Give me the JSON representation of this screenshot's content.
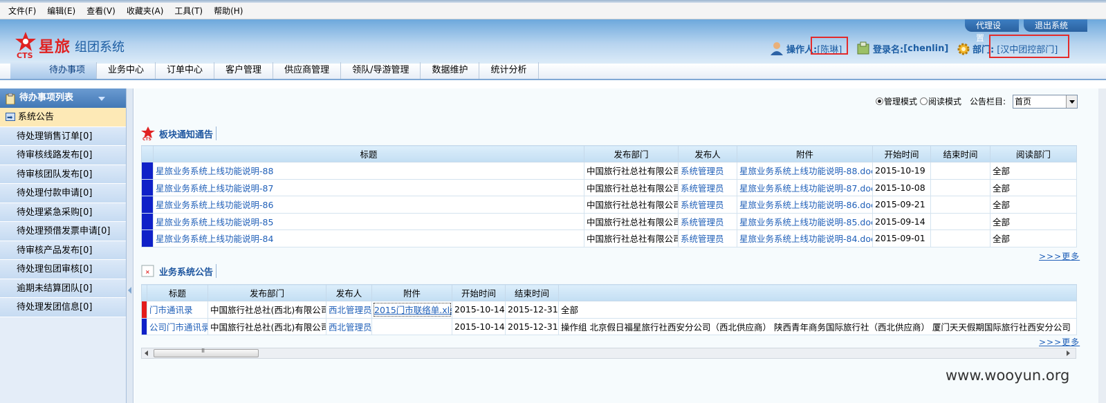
{
  "menu": [
    "文件(F)",
    "编辑(E)",
    "查看(V)",
    "收藏夹(A)",
    "工具(T)",
    "帮助(H)"
  ],
  "header": {
    "brand": "星旅",
    "brand_sub": "组团系统",
    "logo_text": "CTS",
    "proxy_btn": "代理设置",
    "exit_btn": "退出系统",
    "operator_label": "操作人:",
    "operator_value": "[陈琳]",
    "login_label": "登录名:",
    "login_value": "[chenlin]",
    "dept_label": "部门:",
    "dept_value": "[汉中团控部门]"
  },
  "nav": [
    "待办事项",
    "业务中心",
    "订单中心",
    "客户管理",
    "供应商管理",
    "领队/导游管理",
    "数据维护",
    "统计分析"
  ],
  "sidebar": {
    "title": "待办事项列表",
    "notice": "系统公告",
    "items": [
      "待处理销售订单[0]",
      "待审核线路发布[0]",
      "待审核团队发布[0]",
      "待处理付款申请[0]",
      "待处理紧急采购[0]",
      "待处理预借发票申请[0]",
      "待审核产品发布[0]",
      "待处理包团审核[0]",
      "逾期未结算团队[0]",
      "待处理发团信息[0]"
    ]
  },
  "controls": {
    "mode_manage": "管理模式",
    "mode_read": "阅读模式",
    "column_label": "公告栏目:",
    "column_value": "首页"
  },
  "section1": {
    "title": "板块通知通告",
    "headers": [
      "标题",
      "发布部门",
      "发布人",
      "附件",
      "开始时间",
      "结束时间",
      "阅读部门"
    ],
    "rows": [
      {
        "title": "星旅业务系统上线功能说明-88",
        "dept": "中国旅行社总社有限公司",
        "author": "系统管理员",
        "attach": "星旅业务系统上线功能说明-88.doc",
        "start": "2015-10-19",
        "end": "",
        "read": "全部"
      },
      {
        "title": "星旅业务系统上线功能说明-87",
        "dept": "中国旅行社总社有限公司",
        "author": "系统管理员",
        "attach": "星旅业务系统上线功能说明-87.doc",
        "start": "2015-10-08",
        "end": "",
        "read": "全部"
      },
      {
        "title": "星旅业务系统上线功能说明-86",
        "dept": "中国旅行社总社有限公司",
        "author": "系统管理员",
        "attach": "星旅业务系统上线功能说明-86.doc",
        "start": "2015-09-21",
        "end": "",
        "read": "全部"
      },
      {
        "title": "星旅业务系统上线功能说明-85",
        "dept": "中国旅行社总社有限公司",
        "author": "系统管理员",
        "attach": "星旅业务系统上线功能说明-85.doc",
        "start": "2015-09-14",
        "end": "",
        "read": "全部"
      },
      {
        "title": "星旅业务系统上线功能说明-84",
        "dept": "中国旅行社总社有限公司",
        "author": "系统管理员",
        "attach": "星旅业务系统上线功能说明-84.doc",
        "start": "2015-09-01",
        "end": "",
        "read": "全部"
      }
    ],
    "more": ">>>更多"
  },
  "section2": {
    "title": "业务系统公告",
    "headers": [
      "标题",
      "发布部门",
      "发布人",
      "附件",
      "开始时间",
      "结束时间"
    ],
    "rows": [
      {
        "title": "门市通讯录",
        "dept": "中国旅行社总社(西北)有限公司",
        "author": "西北管理员",
        "attach": "2015门市联络单.xls",
        "start": "2015-10-14",
        "end": "2015-12-31",
        "read": "全部",
        "marker": "#e41b1b"
      },
      {
        "title": "公司门市通讯录",
        "dept": "中国旅行社总社(西北)有限公司",
        "author": "西北管理员",
        "attach": "",
        "start": "2015-10-14",
        "end": "2015-12-31",
        "read": "操作组  北京假日福星旅行社西安分公司（西北供应商）  陕西青年商务国际旅行社（西北供应商）  厦门天天假期国际旅行社西安分公司（西北",
        "marker": "#1021c8"
      }
    ],
    "more": ">>>更多"
  },
  "watermark": "www.wooyun.org",
  "colors": {
    "accent": "#1f5fb8",
    "marker_blue": "#1021c8",
    "marker_red": "#e41b1b",
    "brand_red": "#e02222"
  }
}
